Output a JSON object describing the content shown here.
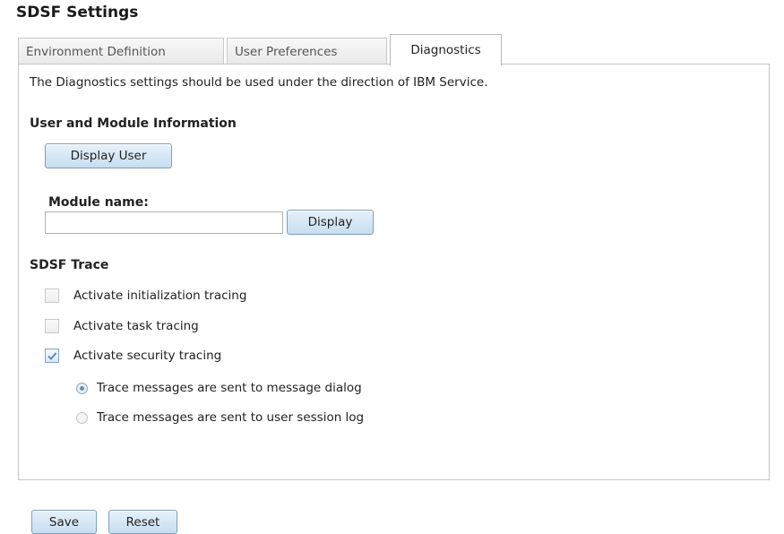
{
  "page": {
    "title": "SDSF Settings"
  },
  "tabs": [
    {
      "label": "Environment Definition",
      "active": false
    },
    {
      "label": "User Preferences",
      "active": false
    },
    {
      "label": "Diagnostics",
      "active": true
    }
  ],
  "diagnostics": {
    "intro": "The Diagnostics settings should be used under the direction of IBM Service.",
    "user_module": {
      "heading": "User and Module Information",
      "display_user_label": "Display User",
      "module_name_label": "Module name:",
      "module_name_value": "",
      "display_label": "Display"
    },
    "trace": {
      "heading": "SDSF Trace",
      "options": [
        {
          "label": "Activate initialization tracing",
          "checked": false
        },
        {
          "label": "Activate task tracing",
          "checked": false
        },
        {
          "label": "Activate security tracing",
          "checked": true
        }
      ],
      "destinations": [
        {
          "label": "Trace messages are sent to message dialog",
          "selected": true
        },
        {
          "label": "Trace messages are sent to user session log",
          "selected": false
        }
      ]
    }
  },
  "footer": {
    "save_label": "Save",
    "reset_label": "Reset"
  },
  "colors": {
    "button_border": "#7e9fbd",
    "button_fill": "#c7def0",
    "check_mark": "#4a88c2"
  }
}
